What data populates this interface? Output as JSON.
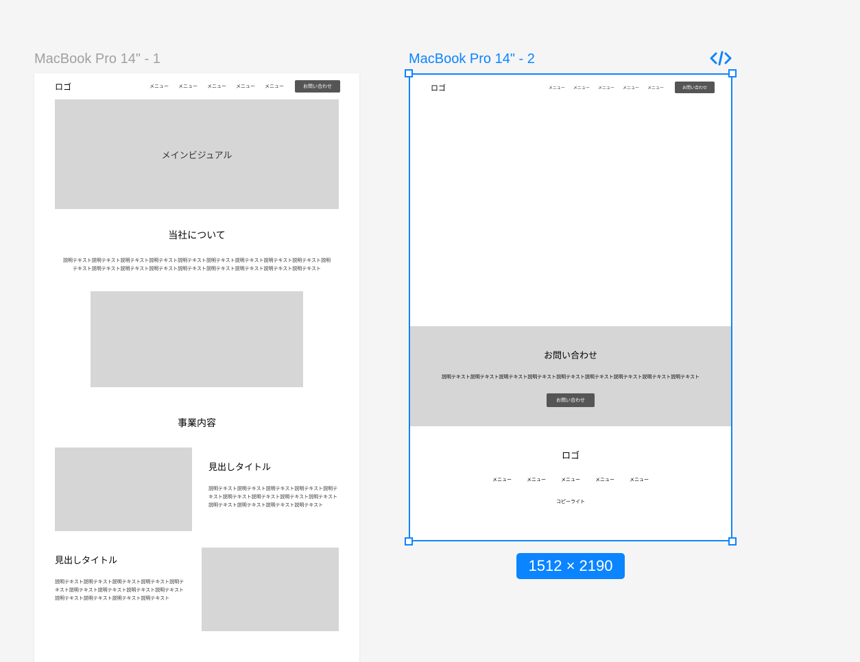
{
  "canvas": {
    "frame1_label": "MacBook Pro 14\" - 1",
    "frame2_label": "MacBook Pro 14\" - 2",
    "selected_dimensions": "1512 × 2190"
  },
  "frame1": {
    "header": {
      "logo": "ロゴ",
      "menu": [
        "メニュー",
        "メニュー",
        "メニュー",
        "メニュー",
        "メニュー"
      ],
      "contact_label": "お問い合わせ"
    },
    "main_visual_label": "メインビジュアル",
    "about": {
      "title": "当社について",
      "body": "説明テキスト説明テキスト説明テキスト説明テキスト説明テキスト説明テキスト説明テキスト説明テキスト説明テキスト説明テキスト説明テキスト説明テキスト説明テキスト説明テキスト説明テキスト説明テキスト説明テキスト説明テキスト"
    },
    "business": {
      "title": "事業内容",
      "items": [
        {
          "heading": "見出しタイトル",
          "body": "説明テキスト説明テキスト説明テキスト説明テキスト説明テキスト説明テキスト説明テキスト説明テキスト説明テキスト説明テキスト説明テキスト説明テキスト説明テキスト"
        },
        {
          "heading": "見出しタイトル",
          "body": "説明テキスト説明テキスト説明テキスト説明テキスト説明テキスト説明テキスト説明テキスト説明テキスト説明テキスト説明テキスト説明テキスト説明テキスト説明テキスト"
        }
      ]
    }
  },
  "frame2": {
    "header": {
      "logo": "ロゴ",
      "menu": [
        "メニュー",
        "メニュー",
        "メニュー",
        "メニュー",
        "メニュー"
      ],
      "contact_label": "お問い合わせ"
    },
    "cta": {
      "title": "お問い合わせ",
      "body": "説明テキスト説明テキスト説明テキスト説明テキスト説明テキスト説明テキスト説明テキスト説明テキスト説明テキスト",
      "button_label": "お問い合わせ"
    },
    "footer": {
      "logo": "ロゴ",
      "menu": [
        "メニュー",
        "メニュー",
        "メニュー",
        "メニュー",
        "メニュー"
      ],
      "copyright": "コピーライト"
    }
  }
}
